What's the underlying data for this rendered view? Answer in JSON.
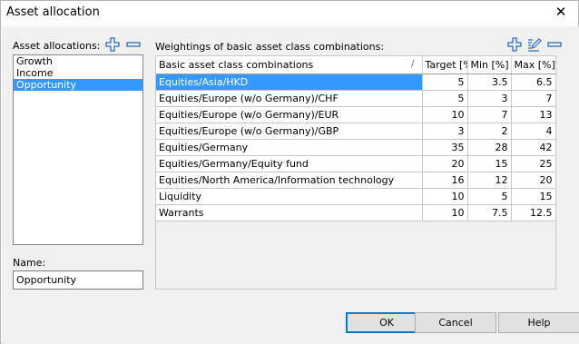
{
  "window": {
    "title": "Asset allocation",
    "close_glyph": "✕"
  },
  "left": {
    "allocations_label": "Asset allocations:",
    "items": [
      "Growth",
      "Income",
      "Opportunity"
    ],
    "selected_index": 2,
    "name_label": "Name:",
    "name_value": "Opportunity"
  },
  "right": {
    "weightings_label": "Weightings of basic asset class combinations:",
    "columns": [
      "Basic asset class combinations",
      "Target [%",
      "Min [%]",
      "Max [%]"
    ],
    "sort_indicator": "∕",
    "selected_row": 0,
    "rows": [
      [
        "Equities/Asia/HKD",
        "5",
        "3.5",
        "6.5"
      ],
      [
        "Equities/Europe (w/o Germany)/CHF",
        "5",
        "3",
        "7"
      ],
      [
        "Equities/Europe (w/o Germany)/EUR",
        "10",
        "7",
        "13"
      ],
      [
        "Equities/Europe (w/o Germany)/GBP",
        "3",
        "2",
        "4"
      ],
      [
        "Equities/Germany",
        "35",
        "28",
        "42"
      ],
      [
        "Equities/Germany/Equity fund",
        "20",
        "15",
        "25"
      ],
      [
        "Equities/North America/Information technology",
        "16",
        "12",
        "20"
      ],
      [
        "Liquidity",
        "10",
        "5",
        "15"
      ],
      [
        "Warrants",
        "10",
        "7.5",
        "12.5"
      ]
    ]
  },
  "buttons": {
    "ok": "OK",
    "cancel": "Cancel",
    "help": "Help"
  },
  "icons": {
    "add": "add-icon",
    "remove": "remove-icon",
    "edit": "edit-icon"
  },
  "colors": {
    "selection": "#3399ff",
    "icon_blue": "#2a6ebb",
    "default_button_border": "#0078d7"
  }
}
